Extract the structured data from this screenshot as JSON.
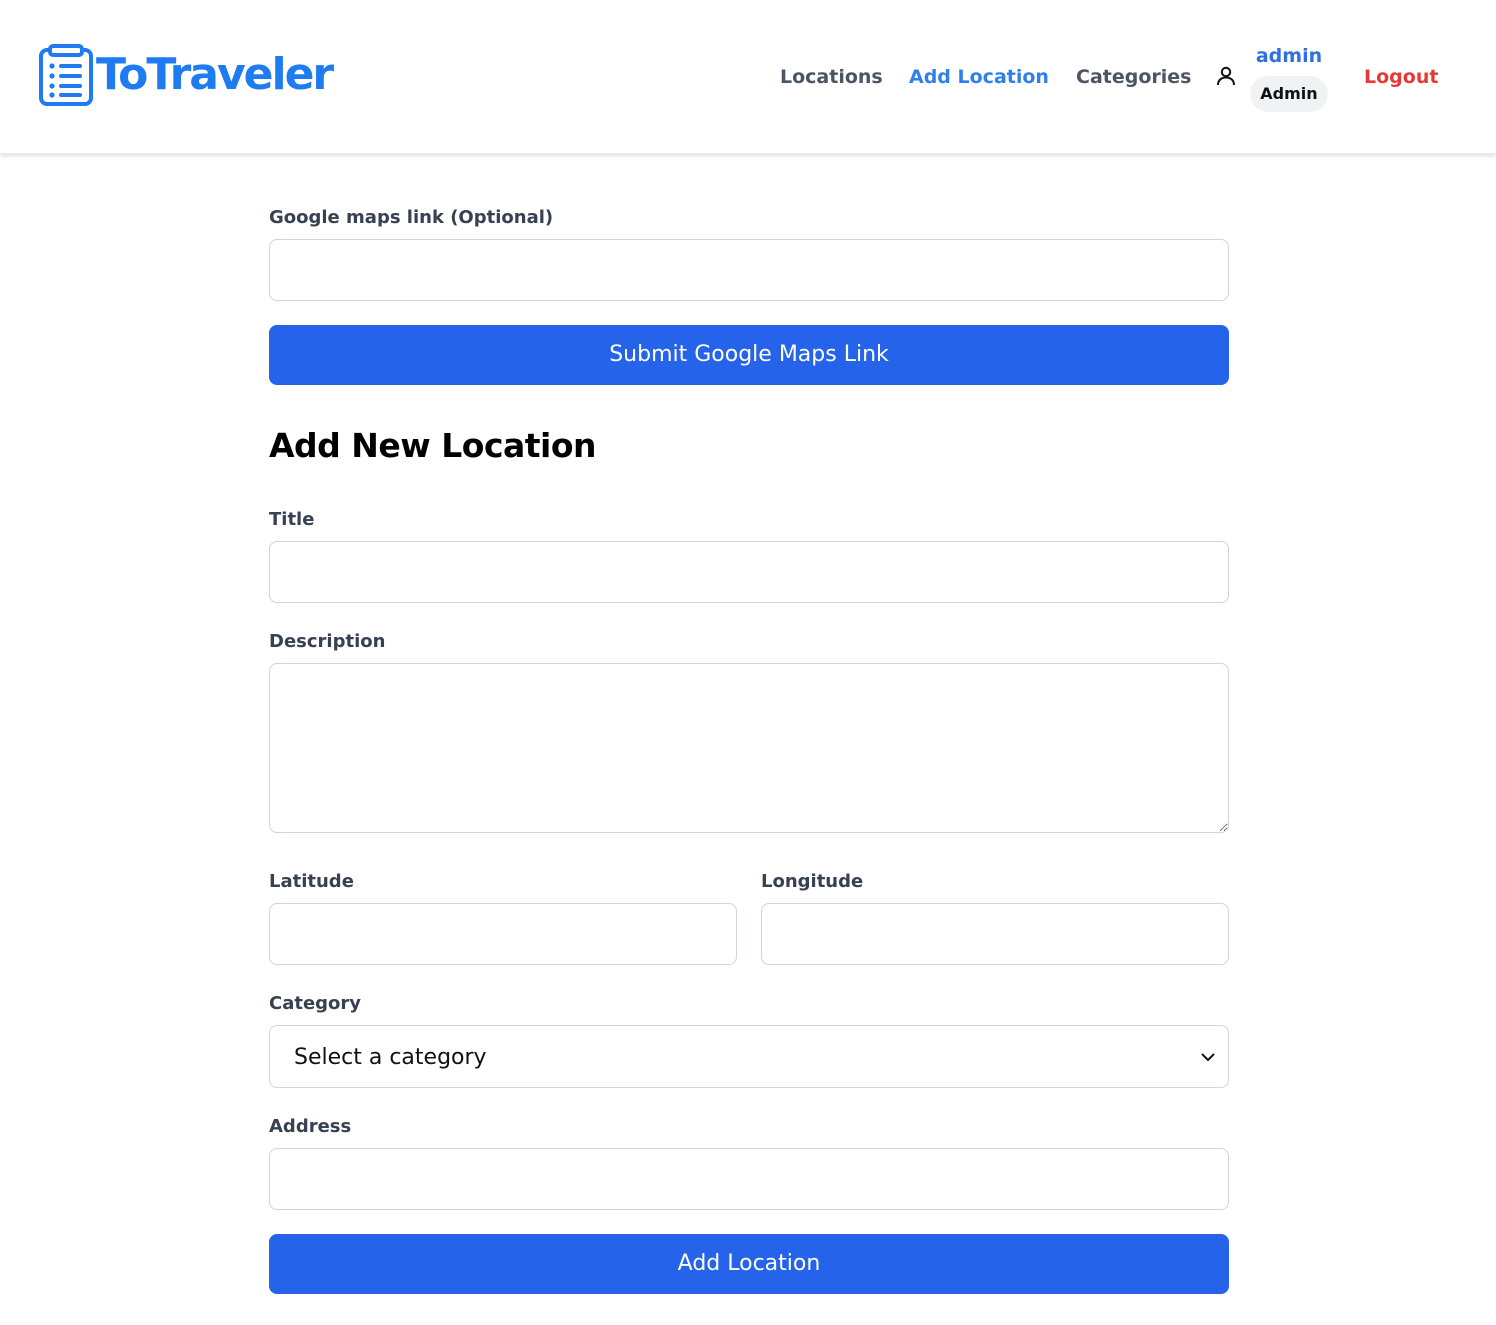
{
  "header": {
    "logo_text": "ToTraveler",
    "nav": {
      "locations": "Locations",
      "add_location": "Add Location",
      "categories": "Categories"
    },
    "user": {
      "name": "admin",
      "role": "Admin"
    },
    "logout": "Logout",
    "icons": [
      "checklist-logo-icon",
      "user-icon"
    ],
    "colors": {
      "brand": "#1e7bf0",
      "active": "#2f80ed",
      "logout": "#e53935"
    }
  },
  "form": {
    "maps_link": {
      "label": "Google maps link (Optional)",
      "value": ""
    },
    "submit_maps_button": "Submit Google Maps Link",
    "heading": "Add New Location",
    "title": {
      "label": "Title",
      "value": ""
    },
    "description": {
      "label": "Description",
      "value": ""
    },
    "latitude": {
      "label": "Latitude",
      "value": ""
    },
    "longitude": {
      "label": "Longitude",
      "value": ""
    },
    "category": {
      "label": "Category",
      "selected": "Select a category"
    },
    "address": {
      "label": "Address",
      "value": ""
    },
    "add_button": "Add Location",
    "colors": {
      "button": "#2563eb"
    }
  }
}
